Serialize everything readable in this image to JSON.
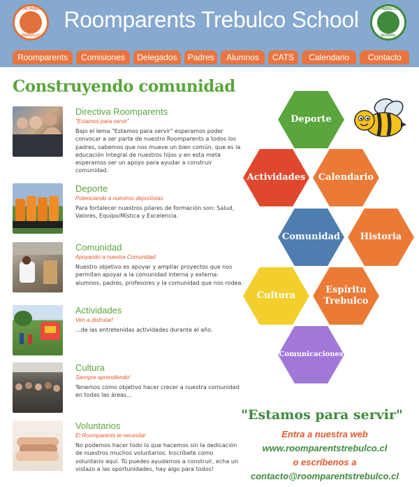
{
  "header": {
    "title": "Roomparents Trebulco School",
    "logo_left_text_top": "ROOM PARENTS",
    "logo_left_text_bottom": "TREBULCO",
    "logo_right_text_top": "TREBULCO",
    "logo_right_text_bottom": "SCHOOL"
  },
  "nav": {
    "items": [
      "Roomparents",
      "Comisiones",
      "Delegados",
      "Padres",
      "Alumnos",
      "CATS",
      "Calendario",
      "Contacto"
    ]
  },
  "main": {
    "heading": "Construyendo comunidad",
    "sections": [
      {
        "title": "Directiva Roomparents",
        "subtitle": "\"Estamos para servir\"",
        "body": "Bajo el lema \"Estamos para servir\" esperamos poder convocar a ser parte de nuestro Roomparents a todos los padres, sabemos que nos mueve un bien común, que es la educación integral de nuestros hijos y en esta meta esperamos ser un apoyo para ayudar a construir comunidad."
      },
      {
        "title": "Deporte",
        "subtitle": "Potenciando a nuestros deportistas",
        "body": "Para fortalecer nuestros pilares de formación son: Salud, Valores, Equipo/Mística y Excelencia."
      },
      {
        "title": "Comunidad",
        "subtitle": "Apoyando a nuestra Comunidad",
        "body": "Nuestro objetivo es apoyar y ampliar proyectos que nos permitan apoyar a la comunidad interna y externa: alumnos, padres, profesores y la comunidad que nos rodea."
      },
      {
        "title": "Actividades",
        "subtitle": "Ven a disfrutar!",
        "body": "...de las entretenidas actividades durante el año."
      },
      {
        "title": "Cultura",
        "subtitle": "Siempre aprendiendo!",
        "body": "Tenemos como objetivo hacer crecer a nuestra comunidad en todas las áreas..."
      },
      {
        "title": "Voluntarios",
        "subtitle": "El Roomparents te necesita!",
        "body": "No podemos hacer todo lo que hacemos sin la dedicación de nuestros muchos voluntarios. Inscríbete como voluntario aquí. Tú puedes ayudarnos a construir, echa un vistazo a las oportunidades, hay algo para todos!"
      }
    ]
  },
  "hexagons": [
    {
      "label": "Deporte",
      "color": "#5aa53c"
    },
    {
      "label": "Actividades",
      "color": "#e0482e"
    },
    {
      "label": "Calendario",
      "color": "#ea7a36"
    },
    {
      "label": "Comunidad",
      "color": "#4e7db0"
    },
    {
      "label": "Historia",
      "color": "#ea7a36"
    },
    {
      "label": "Cultura",
      "color": "#f2cf2c"
    },
    {
      "label": "Espíritu Trebulco",
      "color": "#ea7a36"
    },
    {
      "label": "Comunicaciones",
      "color": "#a177d8"
    }
  ],
  "footer": {
    "slogan": "\"Estamos para servir\"",
    "line1": "Entra a nuestra web",
    "website": "www.roomparentstrebulco.cl",
    "line2": "o escríbenos a",
    "email": "contacto@roomparentstrebulco.cl"
  },
  "colors": {
    "header_bg": "#86a9cf",
    "nav_orange": "#e8753f",
    "accent_green": "#5aa53c",
    "accent_red": "#e2572b"
  },
  "icons": [
    "roomparents-logo",
    "trebulco-school-logo",
    "bee-icon"
  ]
}
